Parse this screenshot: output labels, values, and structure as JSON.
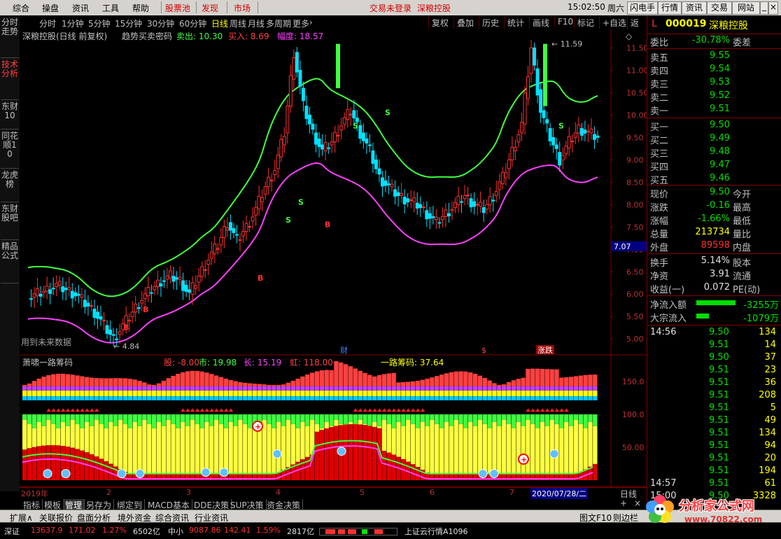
{
  "menu": {
    "items": [
      "综合",
      "操盘",
      "资讯",
      "工具",
      "帮助"
    ],
    "red_items": [
      "股票池",
      "发现",
      "市场"
    ],
    "login_status": "交易未登录",
    "stock_title": "深粮控股",
    "clock": "15:02:50",
    "weekday": "周六",
    "buttons": [
      "闪电手",
      "行情",
      "资讯",
      "交易",
      "网站"
    ]
  },
  "left_tabs": [
    {
      "label": "分时走势",
      "active": false
    },
    {
      "label": "技术分析",
      "active": true
    },
    {
      "label": "东财10",
      "active": false
    },
    {
      "label": "同花顺10",
      "active": false
    },
    {
      "label": "龙虎榜",
      "active": false
    },
    {
      "label": "东财股吧",
      "active": false
    },
    {
      "label": "精品公式",
      "active": false
    }
  ],
  "period_bar": {
    "periods": [
      "分时",
      "1分钟",
      "5分钟",
      "15分钟",
      "30分钟",
      "60分钟",
      "日线",
      "周线",
      "月线",
      "多周期",
      "更多"
    ],
    "active": "日线",
    "tools": [
      "复权",
      "叠加",
      "历史",
      "统计",
      "画线",
      "F10",
      "标记",
      "+自选",
      "返回"
    ]
  },
  "main_chart": {
    "title": "深粮控股(日线 前复权)",
    "indicator_name": "趋势买卖密码",
    "sell_label": "卖出: 10.30",
    "buy_label": "买入: 8.69",
    "range_label": "幅度: 18.57",
    "future_data_note": "用到未来数据",
    "high_label": "11.59",
    "low_label": "4.84",
    "current_price_tag": "7.07",
    "event_labels": [
      "财",
      "$",
      "涨跌"
    ],
    "y_ticks": [
      "11.50",
      "11.00",
      "10.50",
      "10.00",
      "9.50",
      "9.00",
      "8.50",
      "8.00",
      "7.50",
      "7.00",
      "6.50",
      "6.00",
      "5.50",
      "5.00"
    ]
  },
  "chart_data": [
    {
      "type": "candlestick",
      "title": "深粮控股(日线 前复权)",
      "ylim": [
        4.8,
        11.6
      ],
      "close_series_sampled": [
        5.9,
        6.0,
        6.1,
        6.2,
        6.1,
        6.0,
        5.8,
        5.6,
        5.3,
        5.0,
        5.3,
        5.6,
        5.9,
        6.1,
        6.3,
        6.4,
        6.3,
        6.0,
        6.4,
        6.8,
        7.1,
        7.6,
        7.2,
        7.5,
        7.9,
        8.4,
        8.8,
        9.6,
        11.4,
        10.2,
        9.6,
        9.2,
        9.4,
        9.8,
        10.1,
        9.6,
        9.2,
        8.6,
        8.4,
        8.2,
        8.1,
        8.0,
        7.8,
        7.6,
        7.8,
        8.0,
        8.2,
        8.0,
        7.9,
        8.2,
        8.6,
        9.2,
        9.8,
        11.5,
        10.1,
        9.5,
        9.0,
        9.4,
        9.7,
        9.6,
        9.5
      ],
      "upper_band_label": "green band",
      "lower_band_label": "magenta band"
    },
    {
      "type": "bar",
      "title": "萧啸一路筹码",
      "labels": {
        "股": "-8.00",
        "市": "19.98",
        "长": "15.19",
        "虹": "118.00",
        "一路筹码": "37.64"
      },
      "y_ticks": [
        "150.0",
        "100.0",
        "50.00"
      ]
    }
  ],
  "indicator_panel": {
    "name": "萧啸一路筹码",
    "stock_label": "股: -8.00",
    "market_label": "市: 19.98",
    "long_label": "长: 15.19",
    "rainbow_label": "虹: 118.00",
    "chip_label": "一路筹码: 37.64",
    "y_ticks": [
      "150.0",
      "100.0",
      "50.00"
    ]
  },
  "x_axis": {
    "labels": [
      "2019年",
      "2",
      "3",
      "4",
      "5",
      "6",
      "7"
    ],
    "cursor_date": "2020/07/28/二",
    "period_tag": "日线"
  },
  "quote": {
    "market": "L",
    "code": "000019",
    "name": "深粮控股",
    "webi_label": "委比",
    "webi_value": "-30.78%",
    "weicha_label": "委差",
    "asks": [
      {
        "label": "卖五",
        "price": "9.55"
      },
      {
        "label": "卖四",
        "price": "9.54"
      },
      {
        "label": "卖三",
        "price": "9.53"
      },
      {
        "label": "卖二",
        "price": "9.52"
      },
      {
        "label": "卖一",
        "price": "9.51"
      }
    ],
    "bids": [
      {
        "label": "买一",
        "price": "9.50"
      },
      {
        "label": "买二",
        "price": "9.49"
      },
      {
        "label": "买三",
        "price": "9.48"
      },
      {
        "label": "买四",
        "price": "9.47"
      },
      {
        "label": "买五",
        "price": "9.46"
      }
    ],
    "stats": [
      {
        "l": "现价",
        "v": "9.50",
        "c": "grn",
        "l2": "今开"
      },
      {
        "l": "涨跌",
        "v": "-0.16",
        "c": "grn",
        "l2": "最高"
      },
      {
        "l": "涨幅",
        "v": "-1.66%",
        "c": "grn",
        "l2": "最低"
      },
      {
        "l": "总量",
        "v": "213734",
        "c": "yel",
        "l2": "量比"
      },
      {
        "l": "外盘",
        "v": "89598",
        "c": "red",
        "l2": "内盘"
      }
    ],
    "stats2": [
      {
        "l": "换手",
        "v": "5.14%",
        "c": "wht",
        "l2": "股本"
      },
      {
        "l": "净资",
        "v": "3.91",
        "c": "wht",
        "l2": "流通"
      },
      {
        "l": "收益(一)",
        "v": "0.072",
        "c": "wht",
        "l2": "PE(动)"
      }
    ],
    "net_inflow_label": "净流入额",
    "net_inflow_value": "-3255万",
    "block_inflow_label": "大宗流入",
    "block_inflow_value": "-1079万"
  },
  "ticks": {
    "time1": "14:56",
    "time2": "14:57",
    "time3": "15:00",
    "rows": [
      {
        "t": "14:56",
        "p": "9.50",
        "pc": "grn",
        "v": "134"
      },
      {
        "t": "",
        "p": "9.51",
        "pc": "grn",
        "v": "14"
      },
      {
        "t": "",
        "p": "9.50",
        "pc": "grn",
        "v": "37"
      },
      {
        "t": "",
        "p": "9.51",
        "pc": "grn",
        "v": "23"
      },
      {
        "t": "",
        "p": "9.51",
        "pc": "grn",
        "v": "36"
      },
      {
        "t": "",
        "p": "9.51",
        "pc": "grn",
        "v": "208"
      },
      {
        "t": "",
        "p": "9.51",
        "pc": "grn",
        "v": "5"
      },
      {
        "t": "",
        "p": "9.51",
        "pc": "grn",
        "v": "49"
      },
      {
        "t": "",
        "p": "9.51",
        "pc": "grn",
        "v": "134"
      },
      {
        "t": "",
        "p": "9.51",
        "pc": "grn",
        "v": "94"
      },
      {
        "t": "",
        "p": "9.51",
        "pc": "grn",
        "v": "20"
      },
      {
        "t": "",
        "p": "9.51",
        "pc": "grn",
        "v": "194"
      },
      {
        "t": "14:57",
        "p": "9.51",
        "pc": "grn",
        "v": "61"
      },
      {
        "t": "15:00",
        "p": "9.50",
        "pc": "grn",
        "v": "3328"
      }
    ]
  },
  "bottom_tabs": [
    "指标",
    "模板",
    "管理",
    "另存为",
    "绑定到",
    "MACD基本",
    "DDE决策",
    "SUP决策",
    "资金决策"
  ],
  "bottom_active": "管理",
  "bottom_bar": [
    "扩展∧",
    "关联报价",
    "盘面分析",
    "境外资金",
    "综合资讯",
    "行业资讯"
  ],
  "bottom_right": [
    "图文F10",
    "则边栏"
  ],
  "status": {
    "index1_name": "深证",
    "index1_value": "13637.9",
    "index1_change": "171.02",
    "index1_pct": "1.27%",
    "index1_amount": "6502亿",
    "index2_name": "中小",
    "index2_value": "9087.86",
    "index2_change": "142.41",
    "index2_pct": "1.59%",
    "index2_amount": "2817亿",
    "ticker": "上证云行情A1096"
  },
  "watermark": {
    "text": "分析家公式网",
    "url": "www.70822.com"
  },
  "colors": {
    "up": "#ff3030",
    "down": "#00e0ff",
    "band_upper": "#40ff40",
    "band_lower": "#ff40ff",
    "accent": "#ffff00"
  }
}
